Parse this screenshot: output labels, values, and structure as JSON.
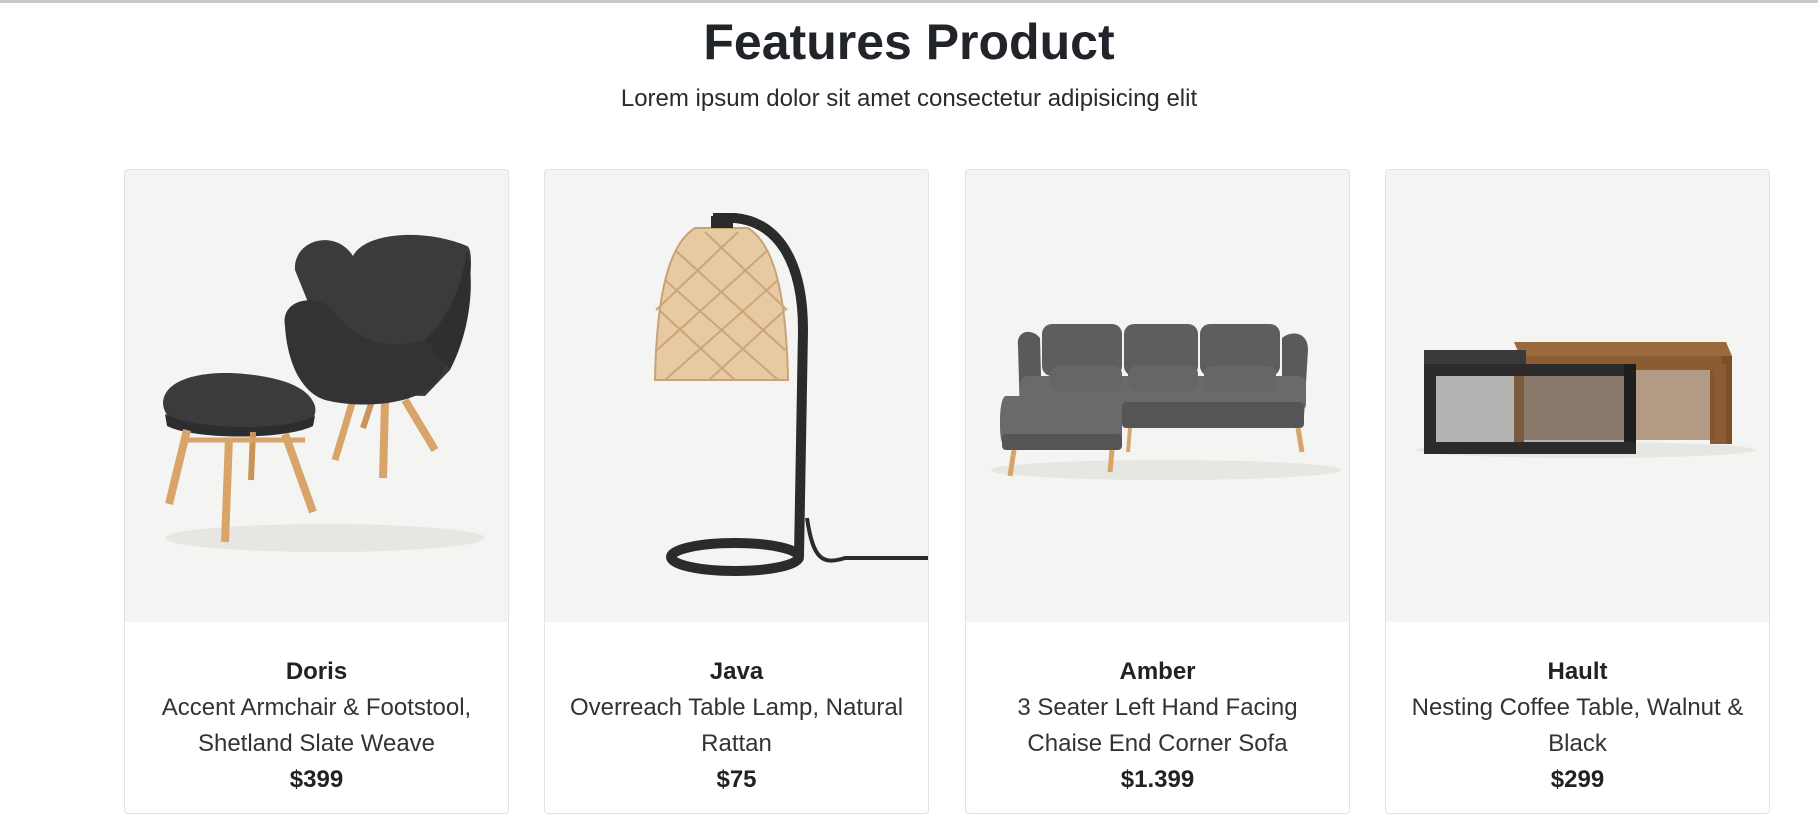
{
  "section": {
    "title": "Features Product",
    "subtitle": "Lorem ipsum dolor sit amet consectetur adipisicing elit"
  },
  "products": [
    {
      "name": "Doris",
      "description": "Accent Armchair & Footstool, Shetland Slate Weave",
      "price": "$399",
      "image": "armchair-footstool-image"
    },
    {
      "name": "Java",
      "description": "Overreach Table Lamp, Natural Rattan",
      "price": "$75",
      "image": "table-lamp-image"
    },
    {
      "name": "Amber",
      "description": "3 Seater Left Hand Facing Chaise End Corner Sofa",
      "price": "$1.399",
      "image": "corner-sofa-image"
    },
    {
      "name": "Hault",
      "description": "Nesting Coffee Table, Walnut & Black",
      "price": "$299",
      "image": "coffee-table-image"
    }
  ],
  "colors": {
    "image_background": "#f4f4f2",
    "upholstery_dark": "#3b3b3d",
    "upholstery_grey": "#5e5e60",
    "wood_light": "#d9a46a",
    "rattan": "#e7c9a2",
    "walnut": "#9a6a3c",
    "black": "#2b2b2b"
  }
}
